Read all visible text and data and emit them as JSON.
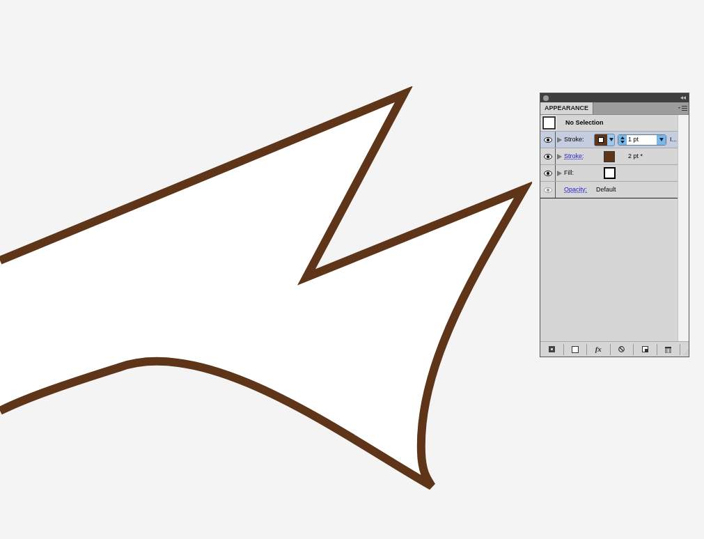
{
  "panel": {
    "tab": "APPEARANCE",
    "header": "No Selection",
    "rows": [
      {
        "kind": "stroke",
        "label": "Stroke:",
        "link": false,
        "selected": true,
        "eye_dimmed": false,
        "expandable": true,
        "color": "#5e3519",
        "weight": "1 pt",
        "extra": "I..."
      },
      {
        "kind": "stroke",
        "label": "Stroke:",
        "link": true,
        "selected": false,
        "eye_dimmed": false,
        "expandable": true,
        "color": "#5e3519",
        "weight": "2 pt *"
      },
      {
        "kind": "fill",
        "label": "Fill:",
        "link": false,
        "selected": false,
        "eye_dimmed": false,
        "expandable": true,
        "color": "#ffffff"
      },
      {
        "kind": "opacity",
        "label": "Opacity:",
        "link": true,
        "selected": false,
        "eye_dimmed": true,
        "expandable": false,
        "value": "Default"
      }
    ],
    "effects_label": "fx"
  }
}
